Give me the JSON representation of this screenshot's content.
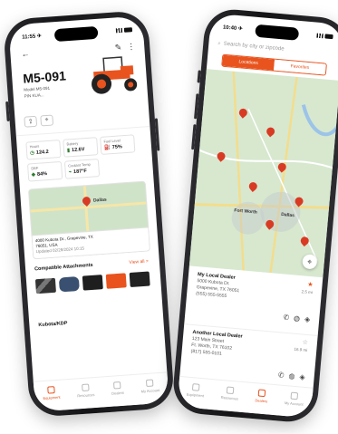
{
  "phone_left": {
    "status": {
      "time": "11:55 ✈"
    },
    "header": {
      "back_icon": "arrow-left-icon",
      "edit_icon": "pencil-icon",
      "more_icon": "more-vertical-icon"
    },
    "equipment": {
      "model": "M5-091",
      "meta_lines": [
        "Model  M5-091",
        "PIN  KUA..."
      ]
    },
    "stats": [
      {
        "label": "Hours",
        "value": "124.2",
        "icon": "◷"
      },
      {
        "label": "Battery",
        "value": "12.6V",
        "icon": "▮"
      },
      {
        "label": "Fuel Level",
        "value": "75%",
        "icon": "⛽"
      },
      {
        "label": "DEF",
        "value": "84%",
        "icon": "◆"
      },
      {
        "label": "Coolant Temp",
        "value": "187°F",
        "icon": "⌁"
      }
    ],
    "map": {
      "pin_label": "Dallas",
      "address_lines": [
        "4000 Kubota Dr., Grapevine, TX",
        "76051, USA",
        "Updated 02/28/2024 10:15"
      ]
    },
    "attachments": {
      "title": "Compatible Attachments",
      "view_all": "View all >"
    },
    "section2": "Kubota/KDP",
    "tabs": [
      {
        "label": "Equipment",
        "active": true
      },
      {
        "label": "Resources",
        "active": false
      },
      {
        "label": "Dealers",
        "active": false
      },
      {
        "label": "My Account",
        "active": false
      }
    ]
  },
  "phone_right": {
    "status": {
      "time": "10:40 ✈"
    },
    "search": {
      "placeholder": "Search by city or zipcode",
      "icon": "search-icon"
    },
    "segment": {
      "left": "Locations",
      "right": "Favorites"
    },
    "map": {
      "city_label": "Fort Worth",
      "city_label2": "Dallas",
      "locate_icon": "crosshair-icon"
    },
    "dealers": [
      {
        "name": "My Local Dealer",
        "lines": [
          "5000 Kubota Dr.",
          "Grapevine, TX 76051",
          "(555) 555-5555"
        ],
        "distance": "2.5 mi"
      },
      {
        "name": "Another Local Dealer",
        "lines": [
          "123 Main Street",
          "Ft. Worth, TX 76102",
          "(817) 555-0101"
        ],
        "distance": "16.9 mi"
      }
    ],
    "tabs": [
      {
        "label": "Equipment",
        "active": false
      },
      {
        "label": "Resources",
        "active": false
      },
      {
        "label": "Dealers",
        "active": true
      },
      {
        "label": "My Account",
        "active": false
      }
    ]
  },
  "colors": {
    "accent": "#e8531e",
    "pin": "#d93a23"
  }
}
